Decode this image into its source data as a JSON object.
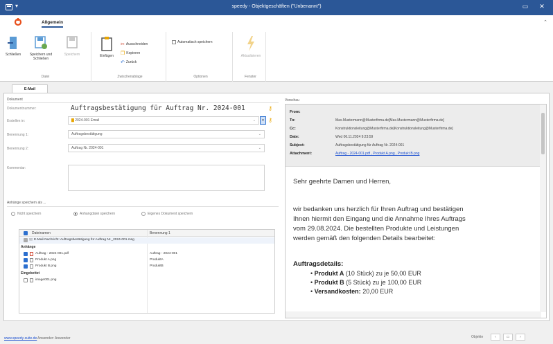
{
  "window": {
    "title": "speedy - Objektgeschäften (\"Unbenannt\")",
    "minimize": "▭",
    "close": "✕"
  },
  "ribbon": {
    "tab_label": "Allgemein",
    "groups": {
      "datei": {
        "name": "Datei",
        "schliessen": "Schließen",
        "speichern_und_schliessen": "Speichern und Schließen",
        "speichern": "Speichern"
      },
      "zwischenablage": {
        "name": "Zwischenablage",
        "einfuegen": "Einfügen",
        "ausschneiden": "Ausschneiden",
        "kopieren": "Kopieren",
        "zurueck": "Zurück"
      },
      "optionen": {
        "name": "Optionen",
        "auto_save": "Automatisch speichern"
      },
      "fenster": {
        "name": "Fenster",
        "aktualisieren": "Aktualisieren"
      }
    }
  },
  "doc_tab": "E-Mail",
  "dokument": {
    "section": "Dokument",
    "nummer_label": "Dokumentnummer:",
    "nummer_value": "Auftragsbestätigung für Auftrag Nr. 2024-001",
    "erstellen_label": "Erstellen in:",
    "erstellen_value": "2024-001 Email",
    "bez1_label": "Benennung 1:",
    "bez1_value": "Auftragsbestätigung",
    "bez2_label": "Benennung 2:",
    "bez2_value": "Auftrag Nr. 2024-001",
    "kommentar_label": "Kommentar:"
  },
  "anhaenge": {
    "section": "Anhänge speichern als ...",
    "options": [
      "Nicht speichern",
      "Anhangdatei speichern",
      "Eigenes Dokument speichern"
    ],
    "selected": 1,
    "col_name": "Dateinamen",
    "col_bez": "Benennung 1",
    "msg_row": "E-Mail-Nachricht: Auftragsbestätigung für Auftrag Nr._2024-001.msg",
    "group_anhaenge": "Anhänge",
    "files": [
      {
        "name": "Auftrag - 2024-001.pdf",
        "bez": "Auftrag - 2024-001",
        "type": "pdf"
      },
      {
        "name": "Produkt A.png",
        "bez": "ProduktA",
        "type": "img"
      },
      {
        "name": "Produkt B.png",
        "bez": "ProduktB",
        "type": "img"
      }
    ],
    "group_eingebettet": "Eingebettet",
    "embedded": [
      {
        "name": "image001.png",
        "bez": ""
      }
    ]
  },
  "vorschau": {
    "section": "Vorschau",
    "from_label": "From:",
    "from_value": "",
    "to_label": "To:",
    "to_value": "Max.Mustermann@Musterfirma.de[Max.Mustermann@Musterfirma.de]",
    "cc_label": "Cc:",
    "cc_value": "Konstruktionsleitung@Musterfirma.de[Konstruktionsleitung@Musterfirma.de]",
    "date_label": "Date:",
    "date_value": "Wed 06.11.2024 9:23:59",
    "subject_label": "Subject:",
    "subject_value": "Auftragsbestätigung für Auftrag Nr. 2024-001",
    "attachment_label": "Attachment:",
    "attachment_value": "Auftrag - 2024-001.pdf , Produkt A.png , Produkt B.png",
    "greeting": "Sehr geehrte Damen und Herren,",
    "para_lines": [
      "wir bedanken uns herzlich für Ihren Auftrag und bestätigen",
      "Ihnen hiermit den Eingang und die Annahme Ihres Auftrags",
      "vom 29.08.2024. Die bestellten Produkte und Leistungen",
      "werden gemäß den folgenden Details bearbeitet:"
    ],
    "details_head": "Auftragsdetails:",
    "details": [
      {
        "bold": "Produkt A",
        "rest": " (10 Stück) zu je 50,00 EUR"
      },
      {
        "bold": "Produkt B",
        "rest": " (5 Stück) zu je 100,00 EUR"
      },
      {
        "bold": "Versandkosten:",
        "rest": " 20,00 EUR"
      }
    ]
  },
  "statusbar": {
    "link": "www.speedy-suite.de",
    "version": "Anwender: Anwender",
    "objekte": "Objekte"
  },
  "colors": {
    "titlebar": "#2b5797",
    "accent": "#2b6fcf",
    "key": "#e8a500"
  }
}
